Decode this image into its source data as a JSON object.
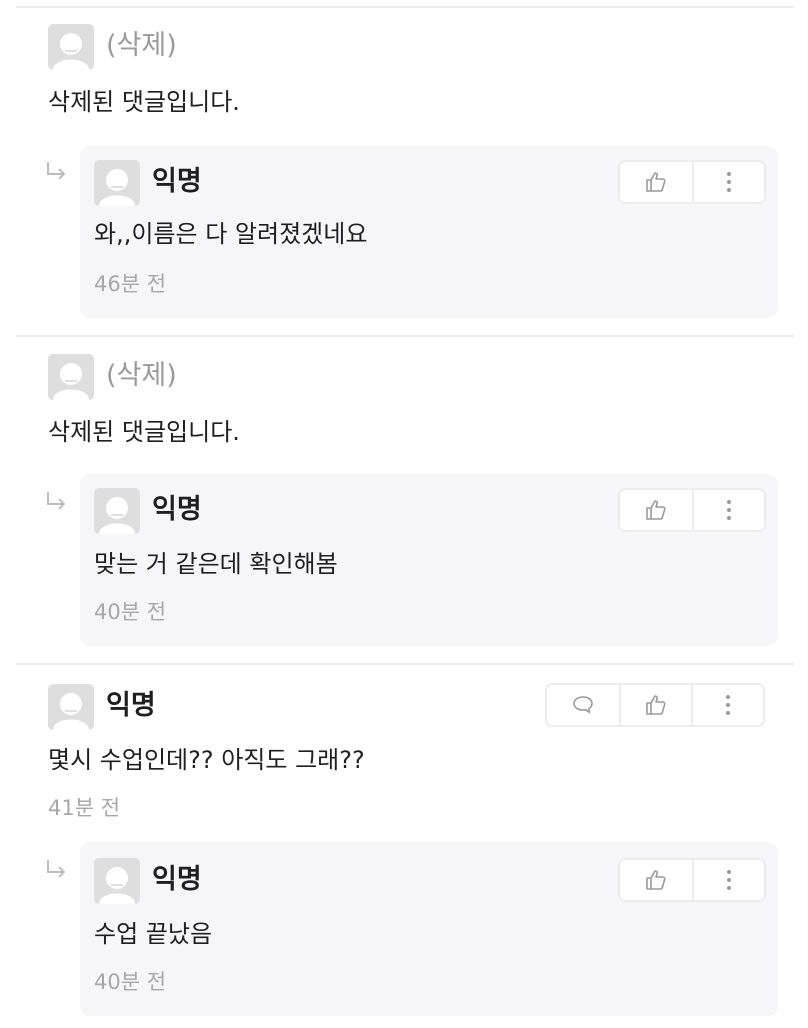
{
  "comments": [
    {
      "author": "(삭제)",
      "text": "삭제된 댓글입니다.",
      "reply": {
        "author": "익명",
        "text": "와,,이름은 다 알려졌겠네요",
        "time": "46분 전"
      }
    },
    {
      "author": "(삭제)",
      "text": "삭제된 댓글입니다.",
      "reply": {
        "author": "익명",
        "text": "맞는 거 같은데 확인해봄",
        "time": "40분 전"
      }
    },
    {
      "author": "익명",
      "text": "몇시 수업인데?? 아직도 그래??",
      "time": "41분 전",
      "reply": {
        "author": "익명",
        "text": "수업 끝났음",
        "time": "40분 전"
      }
    }
  ],
  "icons": {
    "avatar": "default-avatar-icon",
    "reply_arrow": "reply-arrow-icon",
    "like": "thumbs-up-icon",
    "more": "more-vertical-icon",
    "comment": "speech-bubble-icon"
  },
  "colors": {
    "reply_background": "#f6f6f8",
    "deleted_author": "#9a9a9a",
    "meta": "#a7a7a7"
  }
}
